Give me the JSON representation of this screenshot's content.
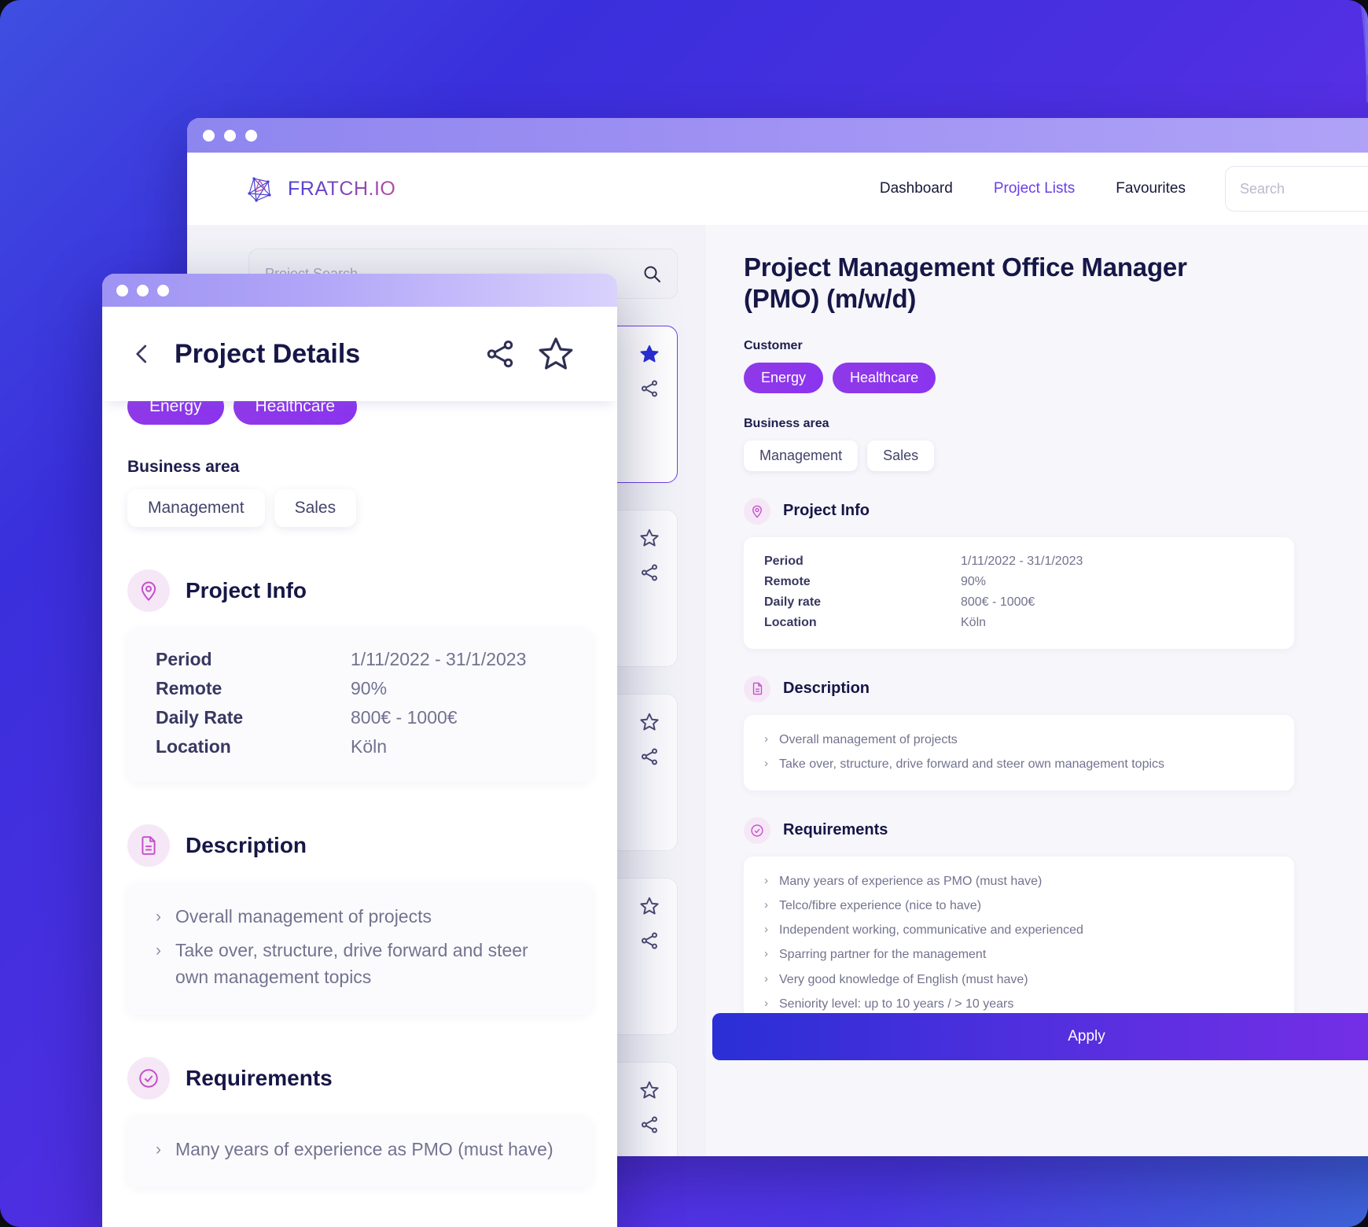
{
  "background": {
    "arc_color": "#7b78f0",
    "gradient_from": "#3f4fe0",
    "gradient_to": "#3d63d8"
  },
  "desktop": {
    "brand": {
      "name": "FRATCH.IO",
      "logo_icon": "polygon-network-logo"
    },
    "nav": [
      {
        "label": "Dashboard",
        "active": false
      },
      {
        "label": "Project Lists",
        "active": true
      },
      {
        "label": "Favourites",
        "active": false
      }
    ],
    "search": {
      "placeholder": "Search",
      "value": "",
      "icon": "search-icon"
    },
    "filter": {
      "placeholder": "Project Search",
      "icon": "search-icon"
    },
    "cards": [
      {
        "favourite": true,
        "selected": true,
        "star_icon": "star-filled-icon",
        "share_icon": "share-icon"
      },
      {
        "favourite": false,
        "selected": false,
        "star_icon": "star-outline-icon",
        "share_icon": "share-icon"
      },
      {
        "favourite": false,
        "selected": false,
        "star_icon": "star-outline-icon",
        "share_icon": "share-icon"
      },
      {
        "favourite": false,
        "selected": false,
        "star_icon": "star-outline-icon",
        "share_icon": "share-icon"
      },
      {
        "favourite": false,
        "selected": false,
        "star_icon": "star-outline-icon",
        "share_icon": "share-icon"
      }
    ],
    "detail": {
      "title": "Project Management Office Manager (PMO) (m/w/d)",
      "customer_label": "Customer",
      "customer_tags": [
        "Energy",
        "Healthcare"
      ],
      "business_area_label": "Business area",
      "business_area_tags": [
        "Management",
        "Sales"
      ],
      "project_info": {
        "heading": "Project Info",
        "icon": "location-pin-icon",
        "rows": [
          {
            "key": "Period",
            "value": "1/11/2022 - 31/1/2023"
          },
          {
            "key": "Remote",
            "value": "90%"
          },
          {
            "key": "Daily rate",
            "value": "800€ - 1000€"
          },
          {
            "key": "Location",
            "value": "Köln"
          }
        ]
      },
      "description": {
        "heading": "Description",
        "icon": "document-icon",
        "items": [
          "Overall management of projects",
          "Take over, structure, drive forward and steer own management topics"
        ]
      },
      "requirements": {
        "heading": "Requirements",
        "icon": "check-circle-icon",
        "items": [
          "Many years of experience as PMO (must have)",
          "Telco/fibre experience (nice to have)",
          "Independent working, communicative and experienced",
          "Sparring partner for the management",
          "Very good knowledge of English (must have)",
          "Seniority level: up to 10 years / > 10 years"
        ]
      },
      "apply_label": "Apply"
    }
  },
  "modal": {
    "title": "Project Details",
    "back_icon": "chevron-left-icon",
    "share_icon": "share-icon",
    "star_icon": "star-outline-icon",
    "customer_tags": [
      "Energy",
      "Healthcare"
    ],
    "business_area_label": "Business area",
    "business_area_tags": [
      "Management",
      "Sales"
    ],
    "project_info": {
      "heading": "Project Info",
      "icon": "location-pin-icon",
      "rows": [
        {
          "key": "Period",
          "value": "1/11/2022 - 31/1/2023"
        },
        {
          "key": "Remote",
          "value": "90%"
        },
        {
          "key": "Daily Rate",
          "value": "800€ - 1000€"
        },
        {
          "key": "Location",
          "value": "Köln"
        }
      ]
    },
    "description": {
      "heading": "Description",
      "icon": "document-icon",
      "items": [
        "Overall management of projects",
        "Take over, structure, drive forward and steer own management topics"
      ]
    },
    "requirements": {
      "heading": "Requirements",
      "icon": "check-circle-icon",
      "items": [
        "Many years of experience as PMO (must have)"
      ]
    }
  },
  "colors": {
    "accent_purple": "#6b3fe8",
    "tag_purple": "#8b34ef",
    "title_navy": "#161647",
    "apply_gradient_from": "#2a2fd6",
    "apply_gradient_to": "#7d2fe8"
  }
}
